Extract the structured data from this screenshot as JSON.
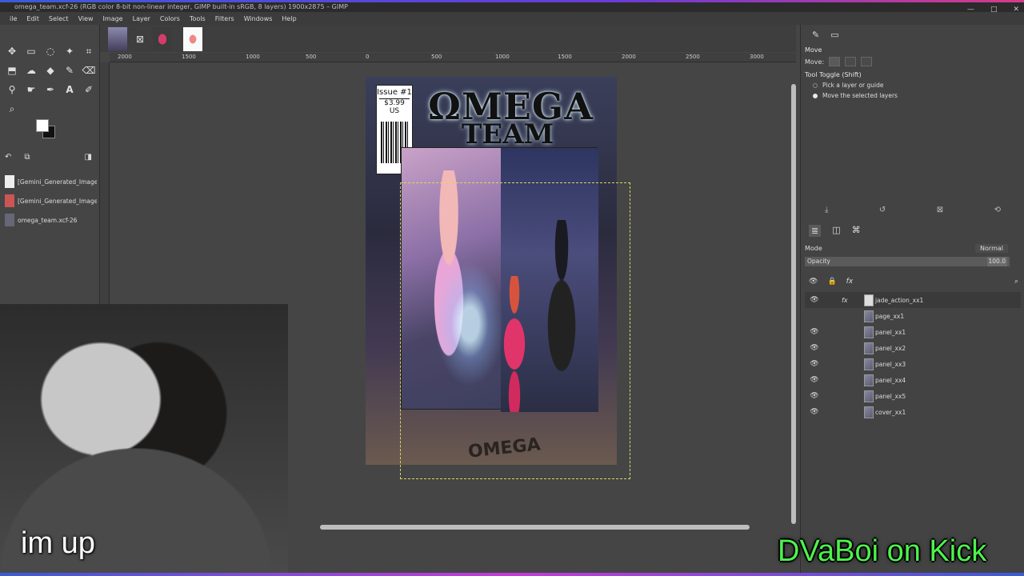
{
  "window": {
    "title": "omega_team.xcf-26 (RGB color 8-bit non-linear integer, GIMP built-in sRGB, 8 layers) 1900x2875 – GIMP"
  },
  "menu": [
    "ile",
    "Edit",
    "Select",
    "View",
    "Image",
    "Layer",
    "Colors",
    "Tools",
    "Filters",
    "Windows",
    "Help"
  ],
  "images_panel": {
    "items": [
      "[Gemini_Generated_Image_c",
      "[Gemini_Generated_Image_",
      "omega_team.xcf-26"
    ]
  },
  "ruler": {
    "ticks": [
      "2000",
      "1500",
      "1000",
      "500",
      "0",
      "500",
      "1000",
      "1500",
      "2000",
      "2500",
      "3000"
    ]
  },
  "cover": {
    "title_top": "ΩMEGA",
    "title_bottom": "TEAM",
    "issue": "Issue #1",
    "price": "$3.99 US",
    "rock_text": "OMEGA"
  },
  "tool_options": {
    "title": "Move",
    "move_label": "Move:",
    "toggle_label": "Tool Toggle (Shift)",
    "option_pick": "Pick a layer or guide",
    "option_move": "Move the selected layers"
  },
  "layers_panel": {
    "mode_label": "Mode",
    "mode_value": "Normal",
    "opacity_label": "Opacity",
    "opacity_value": "100.0",
    "layers": [
      {
        "name": "jade_action_xx1",
        "visible": true,
        "fx": true
      },
      {
        "name": "page_xx1",
        "visible": false,
        "fx": false
      },
      {
        "name": "panel_xx1",
        "visible": true,
        "fx": false
      },
      {
        "name": "panel_xx2",
        "visible": true,
        "fx": false
      },
      {
        "name": "panel_xx3",
        "visible": true,
        "fx": false
      },
      {
        "name": "panel_xx4",
        "visible": true,
        "fx": false
      },
      {
        "name": "panel_xx5",
        "visible": true,
        "fx": false
      },
      {
        "name": "cover_xx1",
        "visible": true,
        "fx": false
      }
    ]
  },
  "overlay": {
    "caption": "im up",
    "brand": "DVaBoi on Kick"
  }
}
